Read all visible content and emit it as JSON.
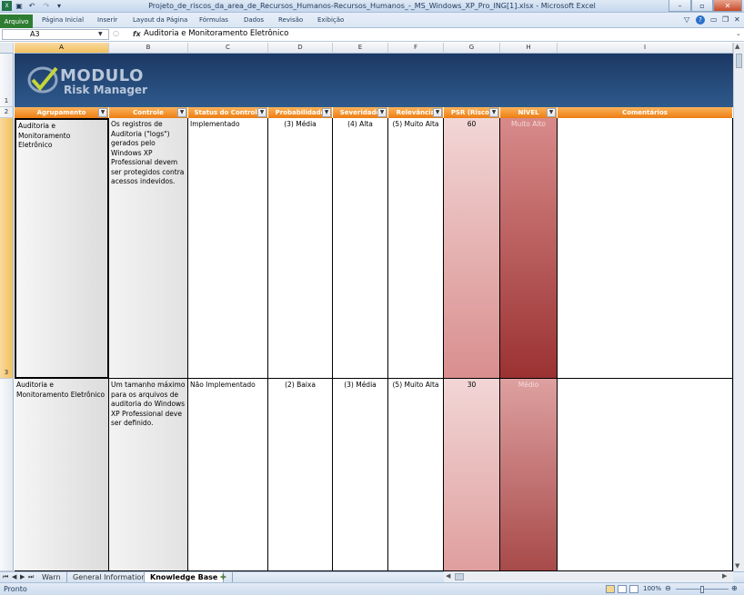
{
  "window": {
    "title": "Projeto_de_riscos_da_area_de_Recursos_Humanos-Recursos_Humanos_-_MS_Windows_XP_Pro_ING[1].xlsx - Microsoft Excel",
    "minimize": "–",
    "maximize": "▫",
    "close": "✕"
  },
  "quick_access": {
    "save": "▣",
    "undo": "↶",
    "redo": "↷",
    "more": "▾"
  },
  "ribbon": {
    "file_tab": "Arquivo",
    "tabs": [
      "Página Inicial",
      "Inserir",
      "Layout da Página",
      "Fórmulas",
      "Dados",
      "Revisão",
      "Exibição"
    ],
    "help": "?"
  },
  "formula_bar": {
    "name_box": "A3",
    "fx": "fx",
    "value": "Auditoria e Monitoramento Eletrônico"
  },
  "columns": [
    "A",
    "B",
    "C",
    "D",
    "E",
    "F",
    "G",
    "H",
    "I"
  ],
  "row_numbers": [
    "1",
    "2",
    "3"
  ],
  "logo": {
    "line1": "MODULO",
    "line2": "Risk Manager"
  },
  "headers": [
    "Agrupamento",
    "Controle",
    "Status do Controle",
    "Probabilidade",
    "Severidade",
    "Relevância",
    "PSR (Risco)",
    "NÍVEL",
    "Comentários"
  ],
  "rows": [
    {
      "agrupamento": "Auditoria e Monitoramento Eletrônico",
      "controle": "Os registros de Auditoria (\"logs\") gerados pelo Windows XP Professional devem ser protegidos contra acessos indevidos.",
      "status": "Implementado",
      "probabilidade": "(3) Média",
      "severidade": "(4) Alta",
      "relevancia": "(5) Muito Alta",
      "psr": "60",
      "nivel": "Muito Alto",
      "comentarios": ""
    },
    {
      "agrupamento": "Auditoria e Monitoramento Eletrônico",
      "controle": "Um tamanho máximo para os arquivos de auditoria do Windows XP Professional deve ser definido.",
      "status": "Não Implementado",
      "probabilidade": "(2) Baixa",
      "severidade": "(3) Média",
      "relevancia": "(5) Muito Alta",
      "psr": "30",
      "nivel": "Médio",
      "comentarios": ""
    }
  ],
  "sheets": {
    "tabs": [
      "Warn",
      "General Information",
      "Knowledge Base"
    ],
    "active": "Knowledge Base",
    "new_sheet": "✚"
  },
  "status": {
    "ready": "Pronto",
    "zoom": "100%"
  },
  "colors": {
    "header_orange": "#ed7d12",
    "banner_blue": "#1c3864",
    "psr_fill": "#e8a8a8",
    "nivel_dark": "#9b3232",
    "group_gray": "#e8e8e8"
  }
}
